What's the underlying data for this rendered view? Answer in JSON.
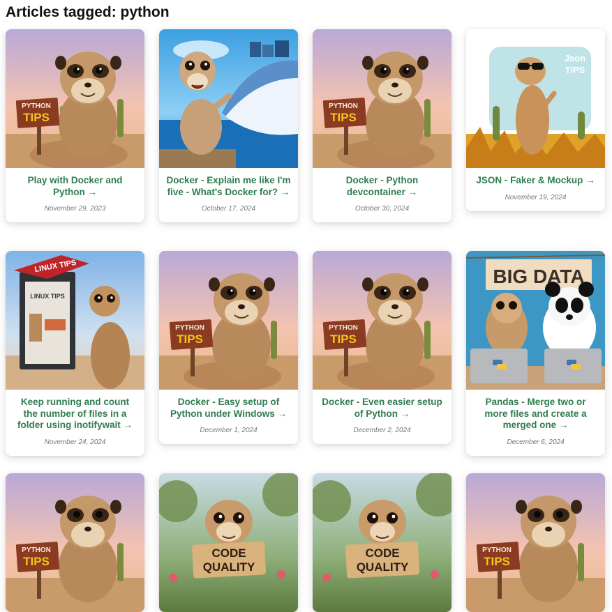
{
  "page": {
    "title": "Articles tagged: python"
  },
  "articles": [
    {
      "title": "Play with Docker and Python →",
      "date": "November 29, 2023",
      "image": "meerkat-python-tips"
    },
    {
      "title": "Docker - Explain me like I'm five - What's Docker for? →",
      "date": "October 17, 2024",
      "image": "meerkat-whale-ship"
    },
    {
      "title": "Docker - Python devcontainer →",
      "date": "October 30, 2024",
      "image": "meerkat-python-tips"
    },
    {
      "title": "JSON - Faker & Mockup →",
      "date": "November 19, 2024",
      "image": "meerkat-json-tips"
    },
    {
      "title": "Keep running and count the number of files in a folder using inotifywait →",
      "date": "November 24, 2024",
      "image": "meerkat-linux-tips"
    },
    {
      "title": "Docker - Easy setup of Python under Windows →",
      "date": "December 1, 2024",
      "image": "meerkat-python-tips"
    },
    {
      "title": "Docker - Even easier setup of Python →",
      "date": "December 2, 2024",
      "image": "meerkat-python-tips"
    },
    {
      "title": "Pandas - Merge two or more files and create a merged one →",
      "date": "December 6, 2024",
      "image": "meerkat-panda-big-data"
    },
    {
      "title": "",
      "date": "",
      "image": "meerkat-python-tips"
    },
    {
      "title": "",
      "date": "",
      "image": "meerkat-code-quality"
    },
    {
      "title": "",
      "date": "",
      "image": "meerkat-code-quality"
    },
    {
      "title": "",
      "date": "",
      "image": "meerkat-python-tips"
    }
  ],
  "signs": {
    "python_top": "PYTHON",
    "python_bottom": "TIPS",
    "linux_banner": "LINUX TIPS",
    "linux_poster": "LINUX TIPS",
    "json_line1": "Json",
    "json_line2": "TiPS",
    "big_data": "BIG DATA",
    "code_line1": "CODE",
    "code_line2": "QUALITY"
  },
  "colors": {
    "link": "#2e7d4f",
    "date": "#777777"
  }
}
